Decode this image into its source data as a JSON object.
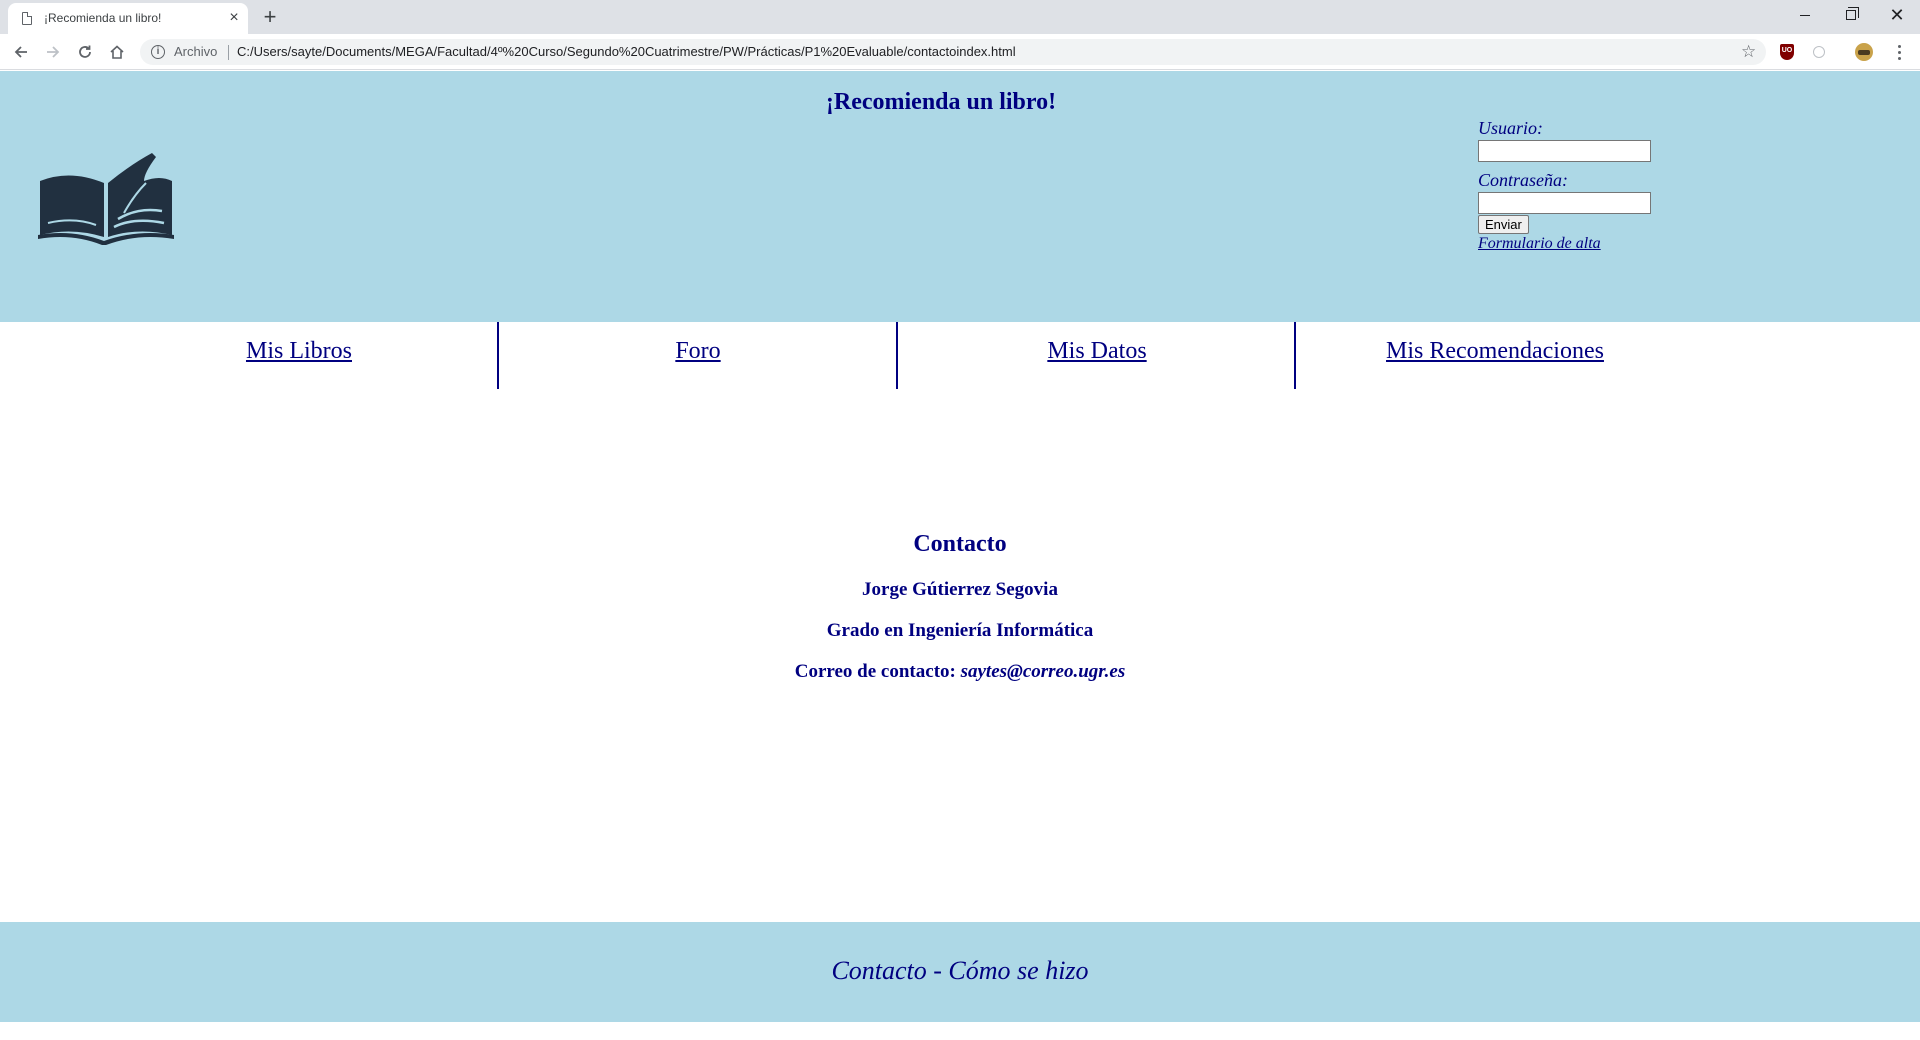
{
  "browser": {
    "tab_title": "¡Recomienda un libro!",
    "tab_close": "×",
    "new_tab": "+",
    "address_chip": "Archivo",
    "url": "C:/Users/sayte/Documents/MEGA/Facultad/4º%20Curso/Segundo%20Cuatrimestre/PW/Prácticas/P1%20Evaluable/contactoindex.html",
    "window_close": "✕",
    "star": "☆",
    "extension_badge": "UO"
  },
  "header": {
    "title": "¡Recomienda un libro!",
    "logo_icon": "open-book-icon",
    "colors": {
      "background": "#add8e6",
      "text": "#000080",
      "logo": "#213040"
    }
  },
  "login": {
    "user_label": "Usuario:",
    "user_value": "",
    "password_label": "Contraseña:",
    "password_value": "",
    "submit_label": "Enviar",
    "signup_link": "Formulario de alta"
  },
  "menu": {
    "items": [
      {
        "label": "Mis Libros"
      },
      {
        "label": "Foro"
      },
      {
        "label": "Mis Datos"
      },
      {
        "label": "Mis Recomendaciones"
      }
    ]
  },
  "contact": {
    "title": "Contacto",
    "name": "Jorge Gútierrez Segovia",
    "degree": "Grado en Ingeniería Informática",
    "email_label": "Correo de contacto:",
    "email": "saytes@correo.ugr.es"
  },
  "footer": {
    "text": "Contacto - Cómo se hizo"
  }
}
